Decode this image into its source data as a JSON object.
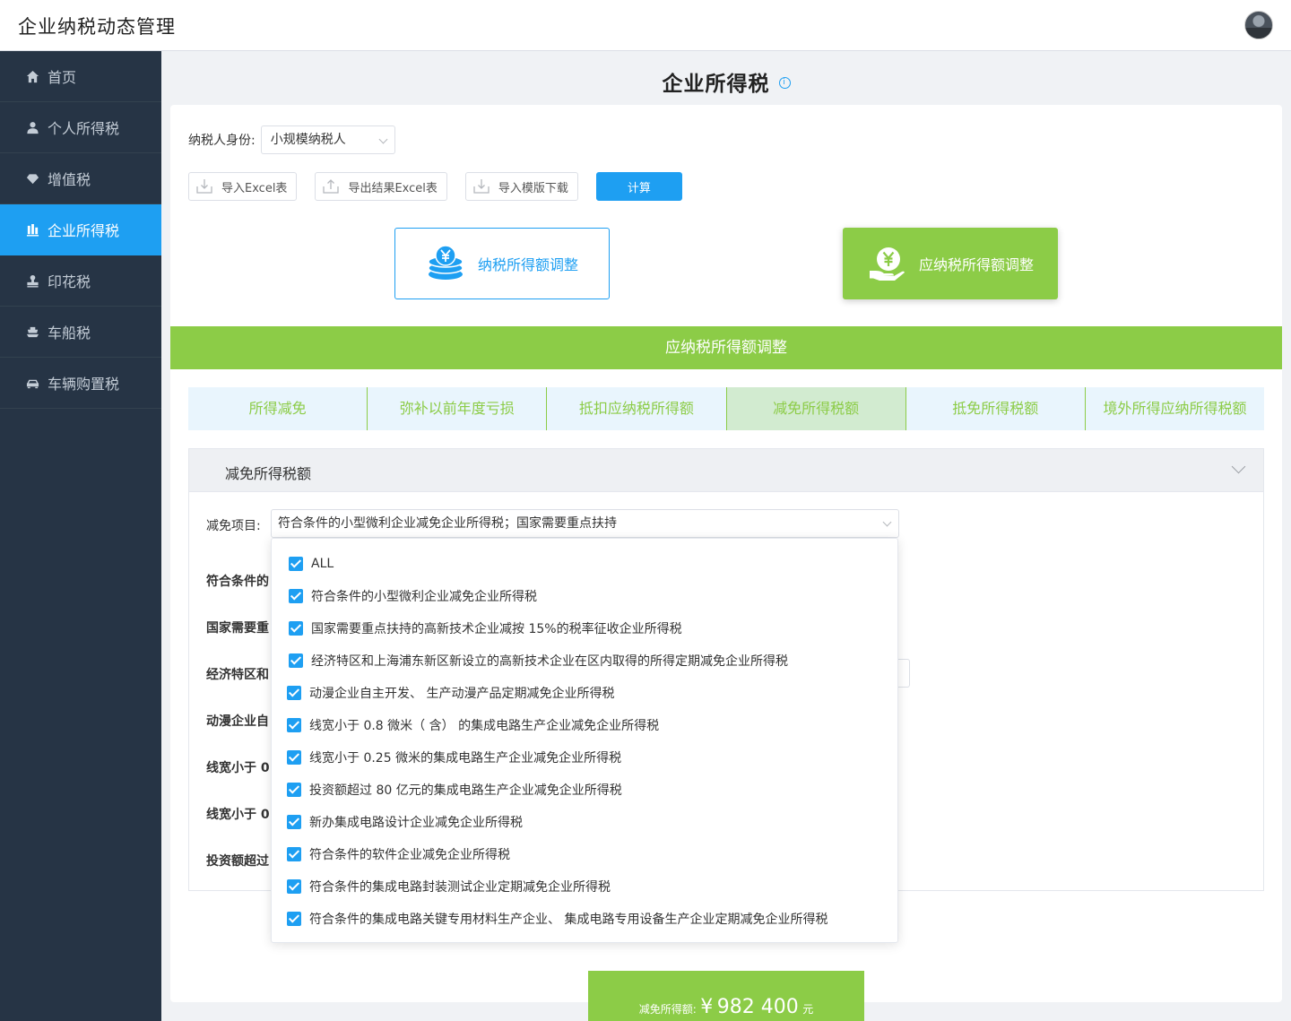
{
  "app": {
    "title": "企业纳税动态管理"
  },
  "sidebar": {
    "items": [
      {
        "label": "首页",
        "icon": "home-icon"
      },
      {
        "label": "个人所得税",
        "icon": "user-icon"
      },
      {
        "label": "增值税",
        "icon": "diamond-icon"
      },
      {
        "label": "企业所得税",
        "icon": "chart-icon",
        "active": true
      },
      {
        "label": "印花税",
        "icon": "stamp-icon"
      },
      {
        "label": "车船税",
        "icon": "ship-icon"
      },
      {
        "label": "车辆购置税",
        "icon": "car-icon"
      }
    ]
  },
  "page": {
    "title": "企业所得税",
    "info_glyph": "i"
  },
  "form": {
    "taxpayer_label": "纳税人身份:",
    "taxpayer_value": "小规模纳税人"
  },
  "toolbar": {
    "import_excel": "导入Excel表",
    "export_excel": "导出结果Excel表",
    "import_template": "导入模版下载",
    "calculate": "计算"
  },
  "cards": {
    "taxable_income_adjust": "纳税所得额调整",
    "assessable_income_adjust": "应纳税所得额调整"
  },
  "section": {
    "title": "应纳税所得额调整"
  },
  "tabs": [
    {
      "label": "所得减免"
    },
    {
      "label": "弥补以前年度亏损"
    },
    {
      "label": "抵扣应纳税所得额"
    },
    {
      "label": "减免所得税额",
      "active": true
    },
    {
      "label": "抵免所得税额"
    },
    {
      "label": "境外所得应纳所得税额"
    }
  ],
  "panel": {
    "title": "减免所得税额",
    "item_label": "减免项目:",
    "item_value": "符合条件的小型微利企业减免企业所得税；国家需要重点扶持",
    "field_labels": [
      "符合条件的",
      "国家需要重",
      "经济特区和",
      "动漫企业自",
      "线宽小于 0.",
      "线宽小于 0.",
      "投资额超过"
    ]
  },
  "dropdown": {
    "options": [
      "ALL",
      "符合条件的小型微利企业减免企业所得税",
      "国家需要重点扶持的高新技术企业减按 15%的税率征收企业所得税",
      "经济特区和上海浦东新区新设立的高新技术企业在区内取得的所得定期减免企业所得税",
      "动漫企业自主开发、 生产动漫产品定期减免企业所得税",
      "线宽小于 0.8 微米（ 含） 的集成电路生产企业减免企业所得税",
      "线宽小于 0.25 微米的集成电路生产企业减免企业所得税",
      "投资额超过 80 亿元的集成电路生产企业减免企业所得税",
      "新办集成电路设计企业减免企业所得税",
      "符合条件的软件企业减免企业所得税",
      "符合条件的集成电路封装测试企业定期减免企业所得税",
      "符合条件的集成电路关键专用材料生产企业、 集成电路专用设备生产企业定期减免企业所得税"
    ]
  },
  "result": {
    "label": "减免所得额:",
    "currency": "¥",
    "value": "982 400",
    "unit": "元"
  },
  "colors": {
    "primary": "#1e9ff2",
    "green": "#8ccc47",
    "sidebar": "#263445"
  }
}
